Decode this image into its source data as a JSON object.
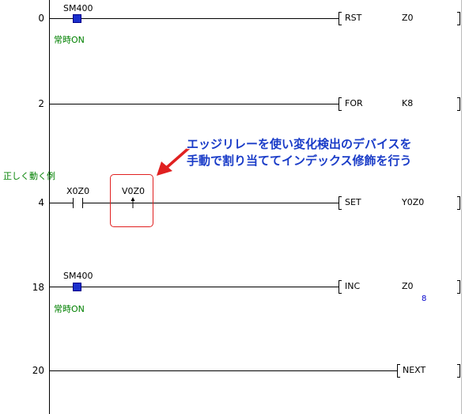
{
  "rungs": [
    {
      "step": "0",
      "contact": "SM400",
      "comment": "常時ON",
      "instruction": "RST",
      "operand": "Z0",
      "operand2": ""
    },
    {
      "step": "2",
      "instruction": "FOR",
      "operand": "K8"
    },
    {
      "step": "4",
      "statement": "正しく動く例",
      "contact": "X0Z0",
      "edge_relay": "V0Z0",
      "instruction": "SET",
      "operand": "Y0Z0"
    },
    {
      "step": "18",
      "contact": "SM400",
      "comment": "常時ON",
      "instruction": "INC",
      "operand": "Z0",
      "monitor_value": "8"
    },
    {
      "step": "20",
      "instruction": "NEXT"
    }
  ],
  "callout": {
    "line1": "エッジリレーを使い変化検出のデバイスを",
    "line2": "手動で割り当ててインデックス修飾を行う"
  },
  "colors": {
    "comment_green": "#008000",
    "contact_blue": "#1a2fcc",
    "monitor_blue": "#0000cc",
    "callout_text": "#1a3cc8",
    "callout_red": "#e02020",
    "highlight_box": "#e02020"
  }
}
